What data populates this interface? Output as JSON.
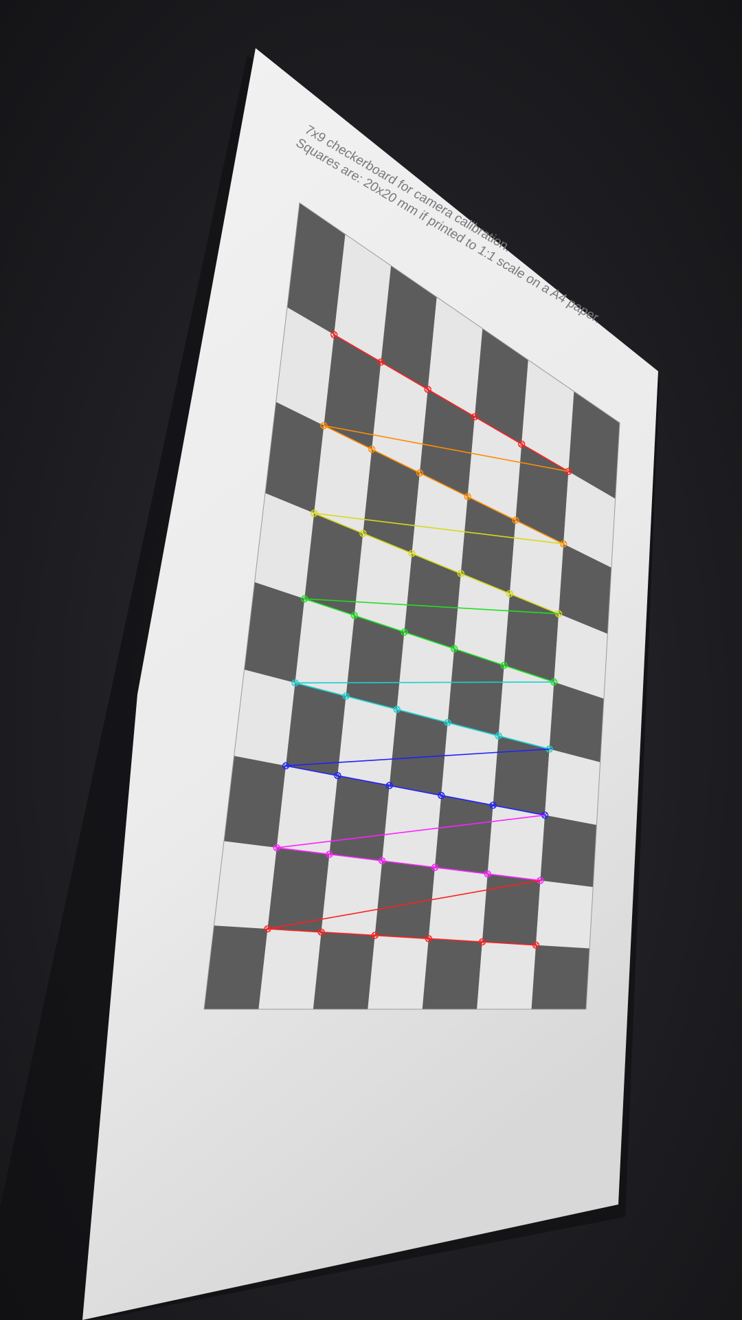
{
  "caption": {
    "line1": "7x9 checkerboard for camera calibration.",
    "line2": "Squares are: 20x20 mm if printed to 1:1 scale on a A4 paper."
  },
  "checkerboard": {
    "columns": 7,
    "rows": 9,
    "square_mm": 20
  },
  "corner_overlay": {
    "rows": 8,
    "corners_per_row": 6,
    "row_colors": [
      "#ff1f1f",
      "#ff8c00",
      "#d9d91a",
      "#1fe01f",
      "#1ad0d0",
      "#2020ff",
      "#ff20ff",
      "#ff1f1f",
      "#ff8c00"
    ]
  },
  "colors": {
    "background": "#1d1d21",
    "paper": "#ebebeb",
    "dark_square": "#5c5c5c",
    "light_square": "#e6e6e6"
  }
}
